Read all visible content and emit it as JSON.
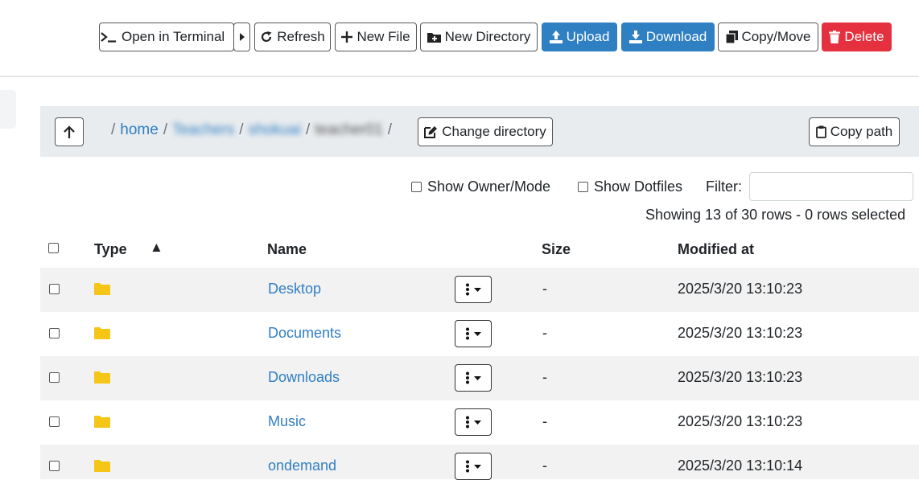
{
  "toolbar": {
    "open_terminal": "Open in Terminal",
    "refresh": "Refresh",
    "new_file": "New File",
    "new_directory": "New Directory",
    "upload": "Upload",
    "download": "Download",
    "copy_move": "Copy/Move",
    "delete": "Delete"
  },
  "breadcrumb": {
    "segments": [
      "home",
      "Teachers",
      "shokuai",
      "teacher01"
    ],
    "change_directory": "Change directory",
    "copy_path": "Copy path"
  },
  "options": {
    "show_owner_mode": "Show Owner/Mode",
    "show_dotfiles": "Show Dotfiles",
    "filter_label": "Filter:",
    "filter_value": ""
  },
  "status": "Showing 13 of 30 rows - 0 rows selected",
  "table": {
    "headers": {
      "type": "Type",
      "name": "Name",
      "size": "Size",
      "modified": "Modified at"
    },
    "sort_indicator": "▲",
    "rows": [
      {
        "name": "Desktop",
        "size": "-",
        "modified": "2025/3/20 13:10:23"
      },
      {
        "name": "Documents",
        "size": "-",
        "modified": "2025/3/20 13:10:23"
      },
      {
        "name": "Downloads",
        "size": "-",
        "modified": "2025/3/20 13:10:23"
      },
      {
        "name": "Music",
        "size": "-",
        "modified": "2025/3/20 13:10:23"
      },
      {
        "name": "ondemand",
        "size": "-",
        "modified": "2025/3/20 13:10:14"
      }
    ]
  },
  "icons": {
    "terminal": "terminal-icon",
    "refresh": "refresh-icon",
    "plus": "plus-icon",
    "folder_plus": "folder-plus-icon",
    "upload": "upload-icon",
    "download": "download-icon",
    "copy": "copy-icon",
    "trash": "trash-icon",
    "arrow_up": "arrow-up-icon",
    "edit": "edit-icon",
    "clipboard": "clipboard-icon",
    "folder": "folder-icon",
    "kebab": "kebab-icon"
  },
  "colors": {
    "primary": "#2f7fc3",
    "danger": "#e5303f",
    "folder": "#f5c518",
    "link": "#2f7fc3"
  }
}
